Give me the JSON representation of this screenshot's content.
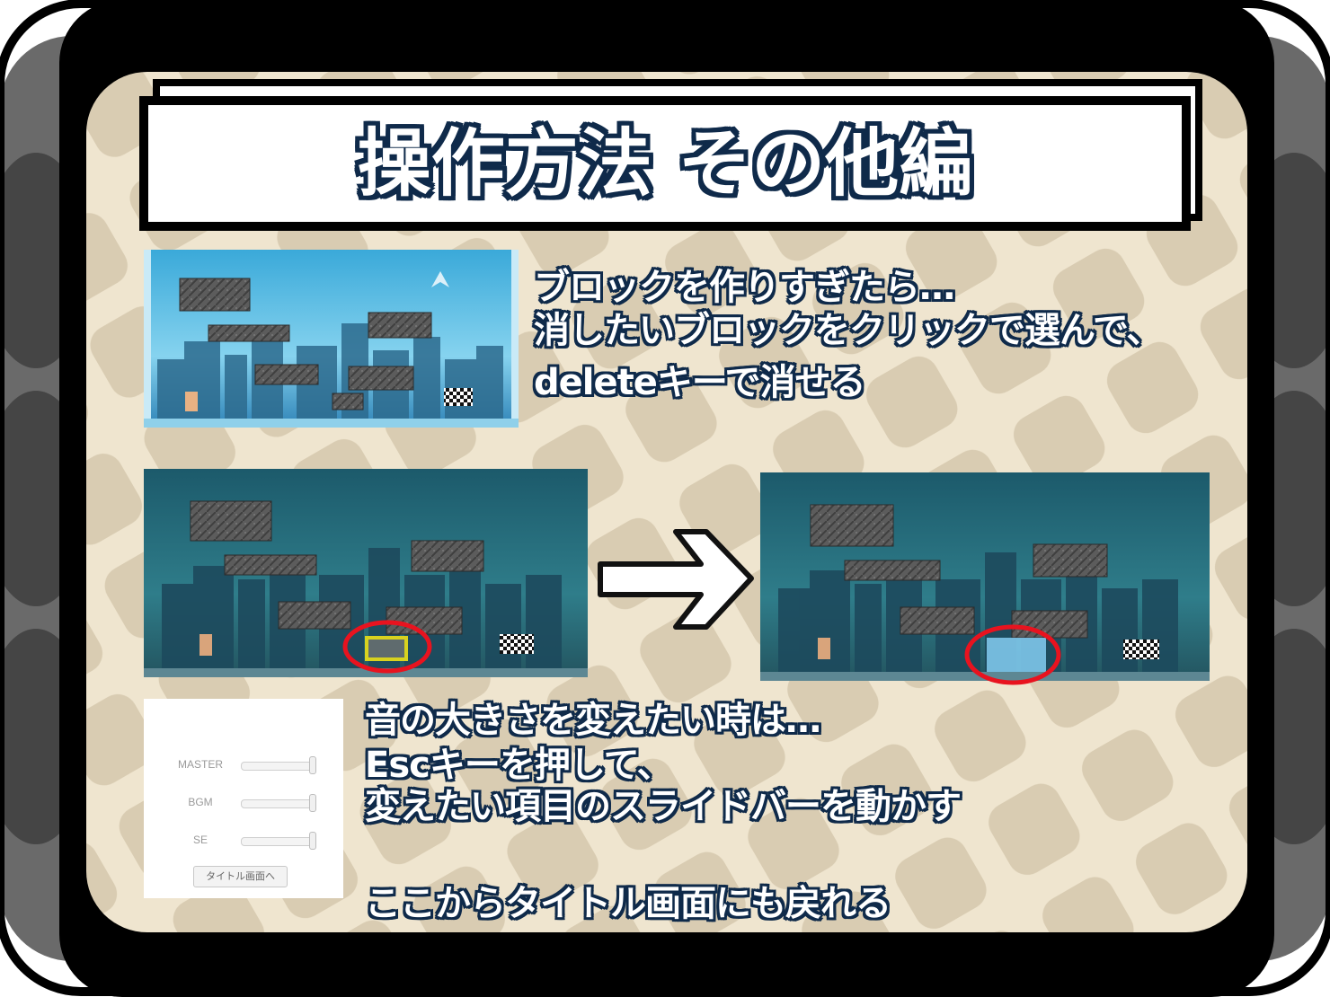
{
  "title": "操作方法 その他編",
  "sections": {
    "delete": {
      "lines": [
        "ブロックを作りすぎたら…",
        "消したいブロックをクリックで選んで、",
        "deleteキーで消せる"
      ]
    },
    "volume": {
      "lines": [
        "音の大きさを変えたい時は…",
        "Escキーを押して、",
        "変えたい項目のスライドバーを動かす"
      ],
      "return_note": "ここからタイトル画面にも戻れる"
    }
  },
  "menu": {
    "labels": [
      "MASTER",
      "BGM",
      "SE"
    ],
    "values": [
      1,
      1,
      1
    ],
    "title_button": "タイトル画面へ"
  },
  "colors": {
    "frame": "#000000",
    "bumper": "#555555",
    "background": "#efe5cf",
    "tiles": "#d9ccb2",
    "text_outline": "#0f2a4a",
    "highlight_circle": "#e8131f",
    "selection_box": "#d8d21f"
  },
  "icons": {
    "arrow": "right-arrow-icon",
    "goal": "checkered-flag-icon"
  }
}
